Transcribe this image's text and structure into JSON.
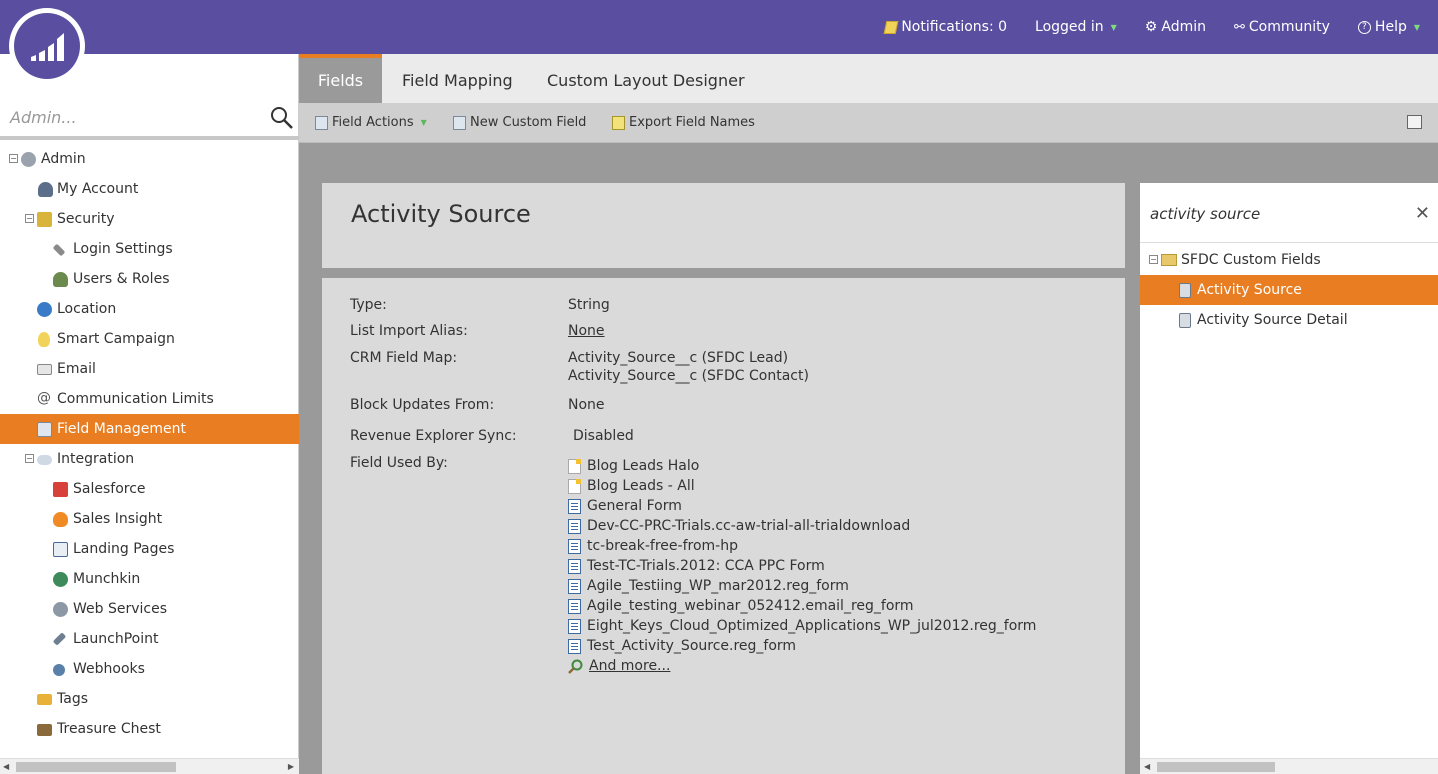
{
  "topnav": {
    "notifications": "Notifications: 0",
    "logged_in": "Logged in",
    "admin": "Admin",
    "community": "Community",
    "help": "Help"
  },
  "sidebar": {
    "search_placeholder": "Admin...",
    "items": [
      {
        "label": "Admin",
        "icon": "gear-icon"
      },
      {
        "label": "My Account",
        "icon": "user-icon"
      },
      {
        "label": "Security",
        "icon": "lock-icon"
      },
      {
        "label": "Login Settings",
        "icon": "key-icon"
      },
      {
        "label": "Users & Roles",
        "icon": "users-icon"
      },
      {
        "label": "Location",
        "icon": "globe-icon"
      },
      {
        "label": "Smart Campaign",
        "icon": "lightbulb-icon"
      },
      {
        "label": "Email",
        "icon": "email-icon"
      },
      {
        "label": "Communication Limits",
        "icon": "at-icon"
      },
      {
        "label": "Field Management",
        "icon": "fields-icon"
      },
      {
        "label": "Integration",
        "icon": "cloud-icon"
      },
      {
        "label": "Salesforce",
        "icon": "salesforce-icon"
      },
      {
        "label": "Sales Insight",
        "icon": "flame-icon"
      },
      {
        "label": "Landing Pages",
        "icon": "page-icon"
      },
      {
        "label": "Munchkin",
        "icon": "munchkin-icon"
      },
      {
        "label": "Web Services",
        "icon": "gears-icon"
      },
      {
        "label": "LaunchPoint",
        "icon": "rocket-icon"
      },
      {
        "label": "Webhooks",
        "icon": "webhook-icon"
      },
      {
        "label": "Tags",
        "icon": "tag-icon"
      },
      {
        "label": "Treasure Chest",
        "icon": "chest-icon"
      }
    ]
  },
  "tabs": [
    {
      "label": "Fields"
    },
    {
      "label": "Field Mapping"
    },
    {
      "label": "Custom Layout Designer"
    }
  ],
  "toolbar": {
    "field_actions": "Field Actions",
    "new_custom_field": "New Custom Field",
    "export_field_names": "Export Field Names"
  },
  "field": {
    "title": "Activity Source",
    "type_label": "Type:",
    "type_value": "String",
    "alias_label": "List Import Alias:",
    "alias_value": "None",
    "crm_label": "CRM Field Map:",
    "crm_value_1": "Activity_Source__c (SFDC Lead)",
    "crm_value_2": "Activity_Source__c (SFDC Contact)",
    "block_label": "Block Updates From:",
    "block_value": "None",
    "revenue_label": "Revenue Explorer Sync:",
    "revenue_value": "Disabled",
    "used_label": "Field Used By:",
    "used_by": [
      {
        "name": "Blog Leads Halo",
        "kind": "list"
      },
      {
        "name": "Blog Leads - All",
        "kind": "list"
      },
      {
        "name": "General Form",
        "kind": "form"
      },
      {
        "name": "Dev-CC-PRC-Trials.cc-aw-trial-all-trialdownload",
        "kind": "form"
      },
      {
        "name": "tc-break-free-from-hp",
        "kind": "form"
      },
      {
        "name": "Test-TC-Trials.2012: CCA PPC Form",
        "kind": "form"
      },
      {
        "name": "Agile_Testiing_WP_mar2012.reg_form",
        "kind": "form"
      },
      {
        "name": "Agile_testing_webinar_052412.email_reg_form",
        "kind": "form"
      },
      {
        "name": "Eight_Keys_Cloud_Optimized_Applications_WP_jul2012.reg_form",
        "kind": "form"
      },
      {
        "name": "Test_Activity_Source.reg_form",
        "kind": "form"
      }
    ],
    "and_more": "And more..."
  },
  "right_panel": {
    "query": "activity source",
    "folder": "SFDC Custom Fields",
    "results": [
      {
        "label": "Activity Source",
        "selected": true
      },
      {
        "label": "Activity Source Detail",
        "selected": false
      }
    ]
  },
  "colors": {
    "topbar": "#5a4ea0",
    "accent": "#e87d22"
  }
}
